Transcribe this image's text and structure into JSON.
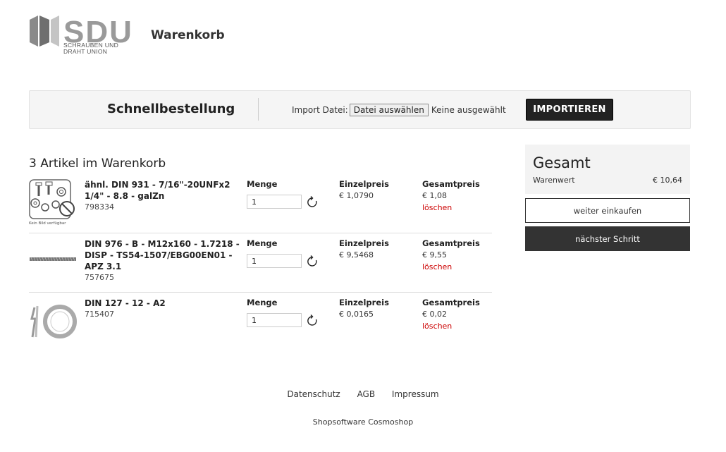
{
  "header": {
    "logo_text": "SDU",
    "logo_tagline_1": "SCHRAUBEN UND",
    "logo_tagline_2": "DRAHT UNION",
    "page_title": "Warenkorb"
  },
  "quick_order": {
    "title": "Schnellbestellung",
    "import_label": "Import Datei:",
    "file_button": "Datei auswählen",
    "file_status": "Keine ausgewählt",
    "import_button": "IMPORTIEREN"
  },
  "cart": {
    "heading": "3 Artikel im Warenkorb",
    "col_qty": "Menge",
    "col_unit": "Einzelpreis",
    "col_total": "Gesamtpreis",
    "delete_label": "löschen",
    "items": [
      {
        "name": "ähnl. DIN 931 - 7/16\"-20UNFx2 1/4\" - 8.8 - galZn",
        "sku": "798334",
        "qty": "1",
        "unit_price": "€ 1,0790",
        "total": "€ 1,08",
        "thumb_caption": "Kein Bild verfügbar"
      },
      {
        "name": "DIN 976 - B - M12x160 - 1.7218 - DISP - TS54-1507/EBG00EN01 - APZ 3.1",
        "sku": "757675",
        "qty": "1",
        "unit_price": "€ 9,5468",
        "total": "€ 9,55"
      },
      {
        "name": "DIN 127 - 12 - A2",
        "sku": "715407",
        "qty": "1",
        "unit_price": "€ 0,0165",
        "total": "€ 0,02"
      }
    ]
  },
  "summary": {
    "title": "Gesamt",
    "label": "Warenwert",
    "value": "€ 10,64",
    "continue_button": "weiter einkaufen",
    "next_button": "nächster Schritt"
  },
  "footer": {
    "links": [
      "Datenschutz",
      "AGB",
      "Impressum"
    ],
    "credit": "Shopsoftware Cosmoshop"
  }
}
